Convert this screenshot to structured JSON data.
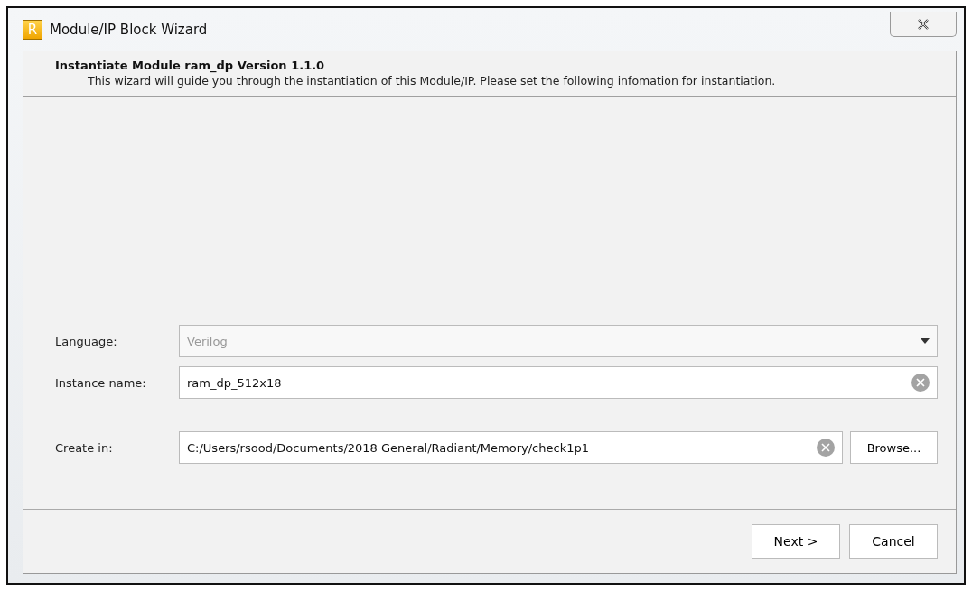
{
  "window": {
    "title": "Module/IP Block Wizard",
    "logo": "R"
  },
  "header": {
    "title": "Instantiate Module ram_dp Version 1.1.0",
    "description": "This wizard will guide you through the instantiation of this Module/IP. Please set the following infomation for instantiation."
  },
  "fields": [
    {
      "kind": "dropdown",
      "label": "Language:",
      "value": "Verilog",
      "disabled": true
    },
    {
      "kind": "text",
      "label": "Instance name:",
      "value": "ram_dp_512x18",
      "disabled": false
    },
    {
      "kind": "path",
      "label": "Create in:",
      "value": "C:/Users/rsood/Documents/2018 General/Radiant/Memory/check1p1",
      "disabled": false,
      "button": "Browse..."
    }
  ],
  "buttons": [
    {
      "label": "Next >"
    },
    {
      "label": "Cancel"
    }
  ]
}
